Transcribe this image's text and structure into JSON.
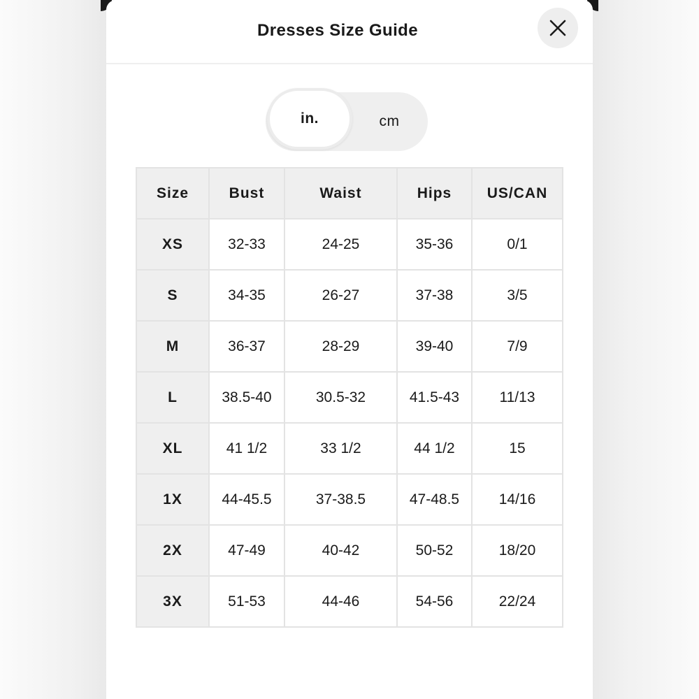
{
  "modal": {
    "title": "Dresses Size Guide",
    "close_icon": "close-icon"
  },
  "unit_toggle": {
    "options": [
      "in.",
      "cm"
    ],
    "selected": "in."
  },
  "size_table": {
    "headers": [
      "Size",
      "Bust",
      "Waist",
      "Hips",
      "US/CAN"
    ],
    "rows": [
      [
        "XS",
        "32-33",
        "24-25",
        "35-36",
        "0/1"
      ],
      [
        "S",
        "34-35",
        "26-27",
        "37-38",
        "3/5"
      ],
      [
        "M",
        "36-37",
        "28-29",
        "39-40",
        "7/9"
      ],
      [
        "L",
        "38.5-40",
        "30.5-32",
        "41.5-43",
        "11/13"
      ],
      [
        "XL",
        "41 1/2",
        "33 1/2",
        "44 1/2",
        "15"
      ],
      [
        "1X",
        "44-45.5",
        "37-38.5",
        "47-48.5",
        "14/16"
      ],
      [
        "2X",
        "47-49",
        "40-42",
        "50-52",
        "18/20"
      ],
      [
        "3X",
        "51-53",
        "44-46",
        "54-56",
        "22/24"
      ]
    ]
  },
  "colors": {
    "header_fill": "#efefef",
    "border": "#e3e3e3",
    "text": "#1a1a1a"
  }
}
